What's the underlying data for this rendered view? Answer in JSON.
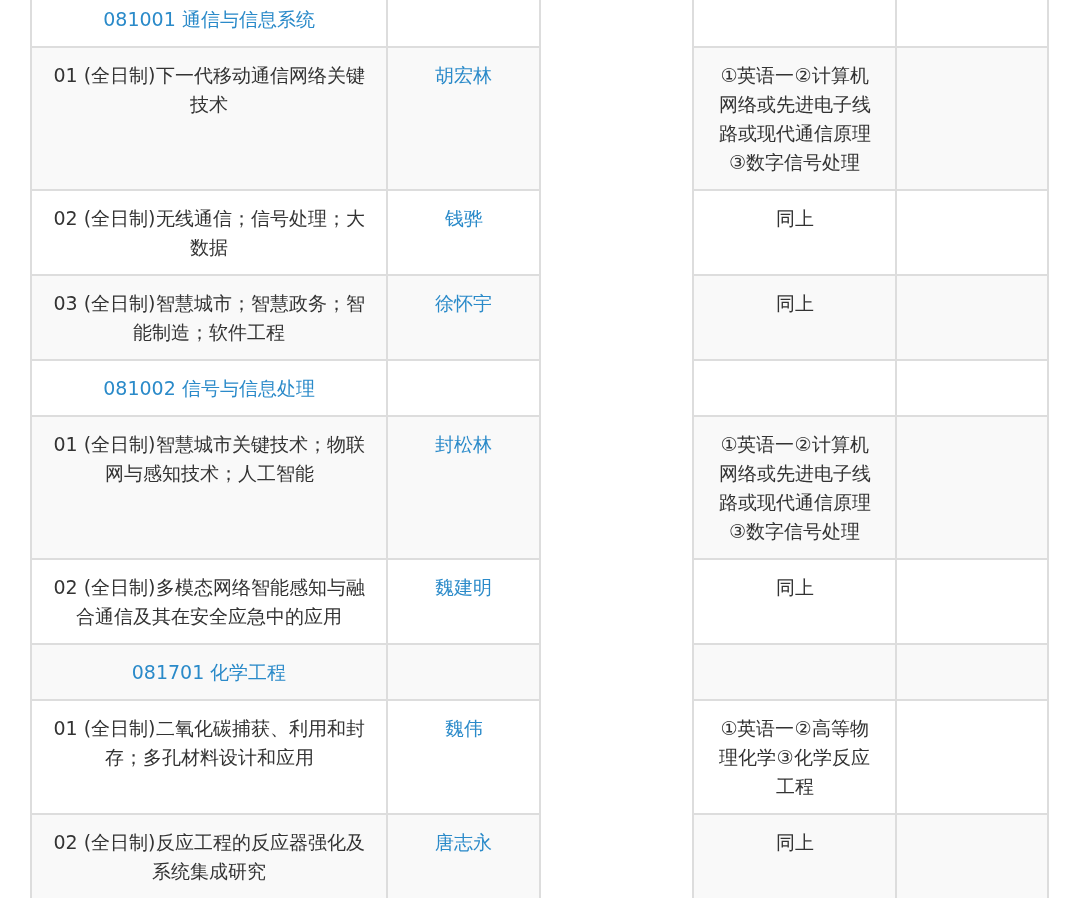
{
  "sections": [
    {
      "heading": "081001 通信与信息系统",
      "directions": [
        {
          "title": "01 (全日制)下一代移动通信网络关键技术",
          "supervisor": "胡宏林",
          "exam": "①英语一②计算机网络或先进电子线路或现代通信原理③数字信号处理"
        },
        {
          "title": "02 (全日制)无线通信；信号处理；大数据",
          "supervisor": "钱骅",
          "exam": "同上"
        },
        {
          "title": "03 (全日制)智慧城市；智慧政务；智能制造；软件工程",
          "supervisor": "徐怀宇",
          "exam": "同上"
        }
      ]
    },
    {
      "heading": "081002 信号与信息处理",
      "directions": [
        {
          "title": "01 (全日制)智慧城市关键技术；物联网与感知技术；人工智能",
          "supervisor": "封松林",
          "exam": "①英语一②计算机网络或先进电子线路或现代通信原理③数字信号处理"
        },
        {
          "title": "02 (全日制)多模态网络智能感知与融合通信及其在安全应急中的应用",
          "supervisor": "魏建明",
          "exam": "同上"
        }
      ]
    },
    {
      "heading": "081701 化学工程",
      "directions": [
        {
          "title": "01 (全日制)二氧化碳捕获、利用和封存；多孔材料设计和应用",
          "supervisor": "魏伟",
          "exam": "①英语一②高等物理化学③化学反应工程"
        },
        {
          "title": "02 (全日制)反应工程的反应器强化及系统集成研究",
          "supervisor": "唐志永",
          "exam": "同上"
        }
      ]
    }
  ]
}
